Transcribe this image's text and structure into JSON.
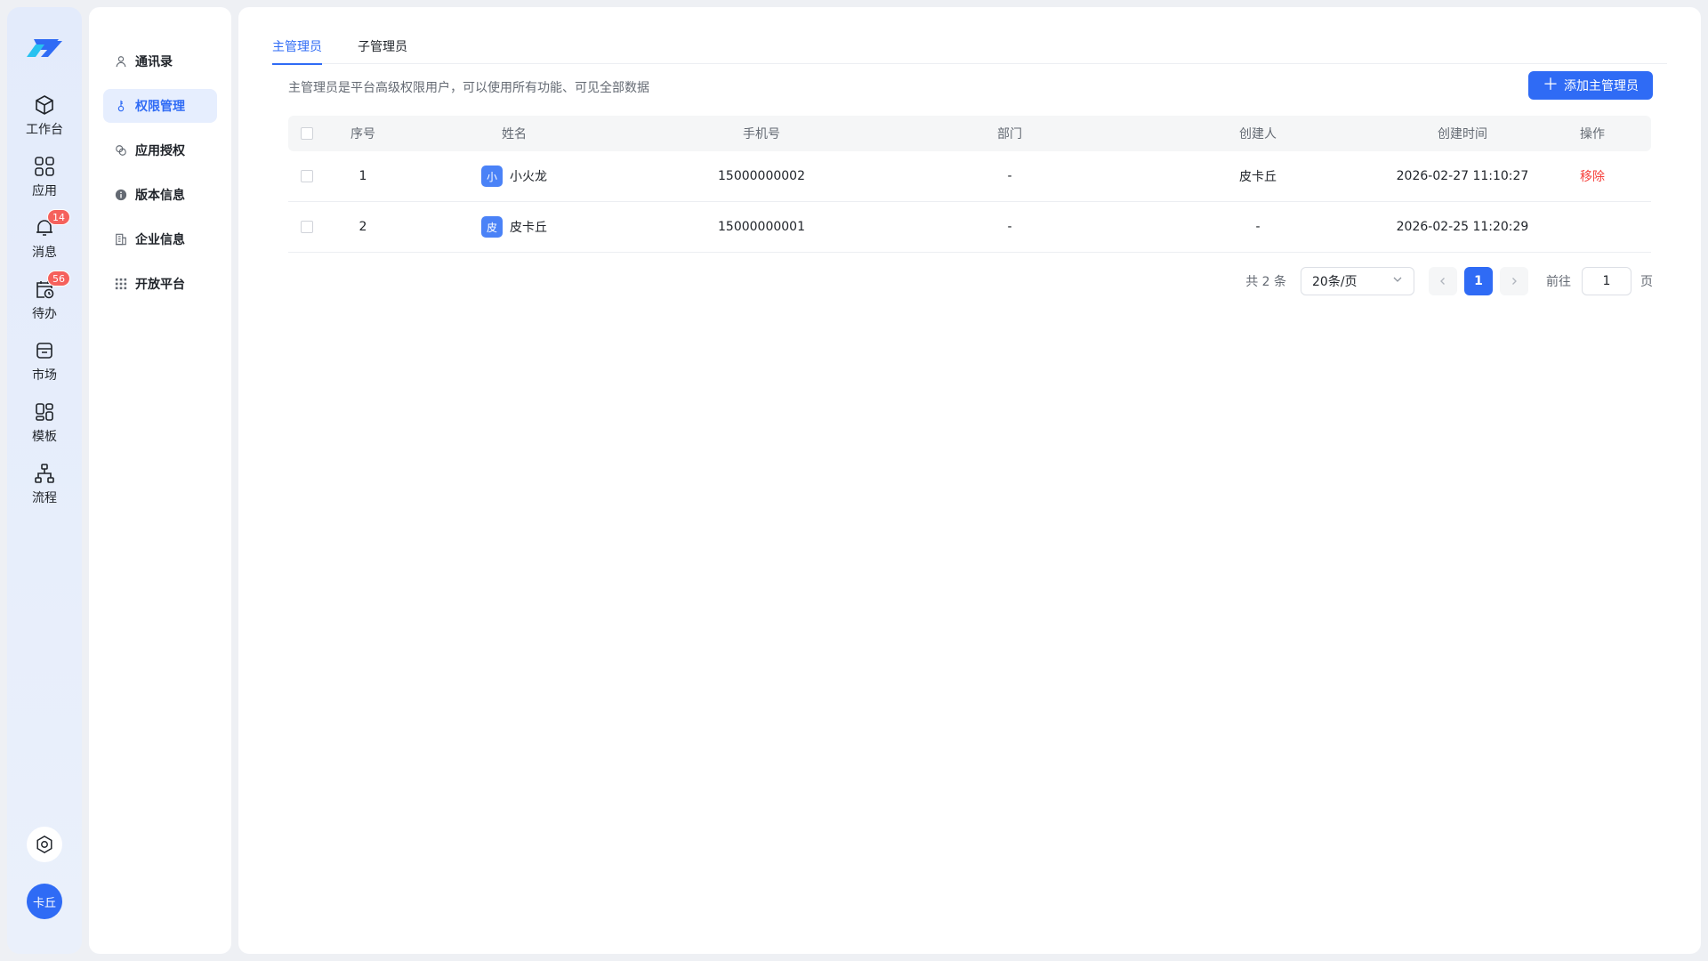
{
  "rail": {
    "items": [
      {
        "label": "工作台",
        "icon": "cube-icon"
      },
      {
        "label": "应用",
        "icon": "grid-icon"
      },
      {
        "label": "消息",
        "icon": "bell-icon",
        "badge": "14"
      },
      {
        "label": "待办",
        "icon": "calendar-clock-icon",
        "badge": "56"
      },
      {
        "label": "市场",
        "icon": "store-icon"
      },
      {
        "label": "模板",
        "icon": "template-icon"
      },
      {
        "label": "流程",
        "icon": "flow-icon"
      }
    ],
    "avatar": "卡丘"
  },
  "subnav": {
    "items": [
      {
        "label": "通讯录",
        "icon": "user-icon"
      },
      {
        "label": "权限管理",
        "icon": "key-icon",
        "active": true
      },
      {
        "label": "应用授权",
        "icon": "link-icon"
      },
      {
        "label": "版本信息",
        "icon": "info-icon"
      },
      {
        "label": "企业信息",
        "icon": "building-icon"
      },
      {
        "label": "开放平台",
        "icon": "dots-grid-icon"
      }
    ]
  },
  "main": {
    "tabs": [
      {
        "label": "主管理员",
        "active": true
      },
      {
        "label": "子管理员"
      }
    ],
    "description": "主管理员是平台高级权限用户，可以使用所有功能、可见全部数据",
    "add_button": "添加主管理员",
    "table": {
      "headers": [
        "序号",
        "姓名",
        "手机号",
        "部门",
        "创建人",
        "创建时间",
        "操作"
      ],
      "rows": [
        {
          "no": "1",
          "avatar": "小",
          "name": "小火龙",
          "phone": "15000000002",
          "dept": "-",
          "creator": "皮卡丘",
          "time": "2026-02-27 11:10:27",
          "op": "移除"
        },
        {
          "no": "2",
          "avatar": "皮",
          "name": "皮卡丘",
          "phone": "15000000001",
          "dept": "-",
          "creator": "-",
          "time": "2026-02-25 11:20:29",
          "op": ""
        }
      ]
    },
    "pagination": {
      "total": "共 2 条",
      "page_size": "20条/页",
      "current": "1",
      "goto_label": "前往",
      "goto_value": "1",
      "unit": "页"
    }
  },
  "colors": {
    "accent": "#2f6bf5",
    "danger": "#f5413c",
    "badge": "#f5615c"
  }
}
